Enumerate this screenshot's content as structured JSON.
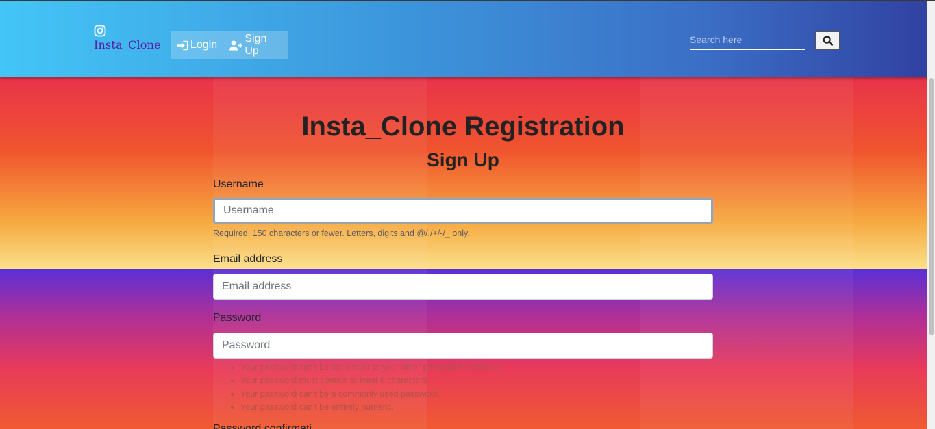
{
  "navbar": {
    "brand_icon": "instagram-icon",
    "brand_name": "Insta_Clone",
    "links": [
      {
        "label": "Login",
        "icon": "sign-in-icon"
      },
      {
        "label": "Sign Up",
        "icon": "user-plus-icon"
      }
    ],
    "search": {
      "placeholder": "Search here",
      "value": "",
      "button_icon": "search-icon"
    }
  },
  "form": {
    "title": "Insta_Clone Registration",
    "subtitle": "Sign Up",
    "username": {
      "label": "Username",
      "placeholder": "Username",
      "help": "Required. 150 characters or fewer. Letters, digits and @/./+/-/_ only."
    },
    "email": {
      "label": "Email address",
      "placeholder": "Email address"
    },
    "password": {
      "label": "Password",
      "placeholder": "Password",
      "help": [
        "Your password can't be too similar to your other personal information.",
        "Your password must contain at least 8 characters.",
        "Your password can't be a commonly used password.",
        "Your password can't be entirely numeric."
      ]
    },
    "next_label_partial": "Password confirmati"
  },
  "colors": {
    "nav_start": "#43c5f7",
    "nav_end": "#3040a0",
    "brand": "#5a1aa3",
    "bg_orange": "#f0542e",
    "bg_purple": "#5a2fd6"
  }
}
